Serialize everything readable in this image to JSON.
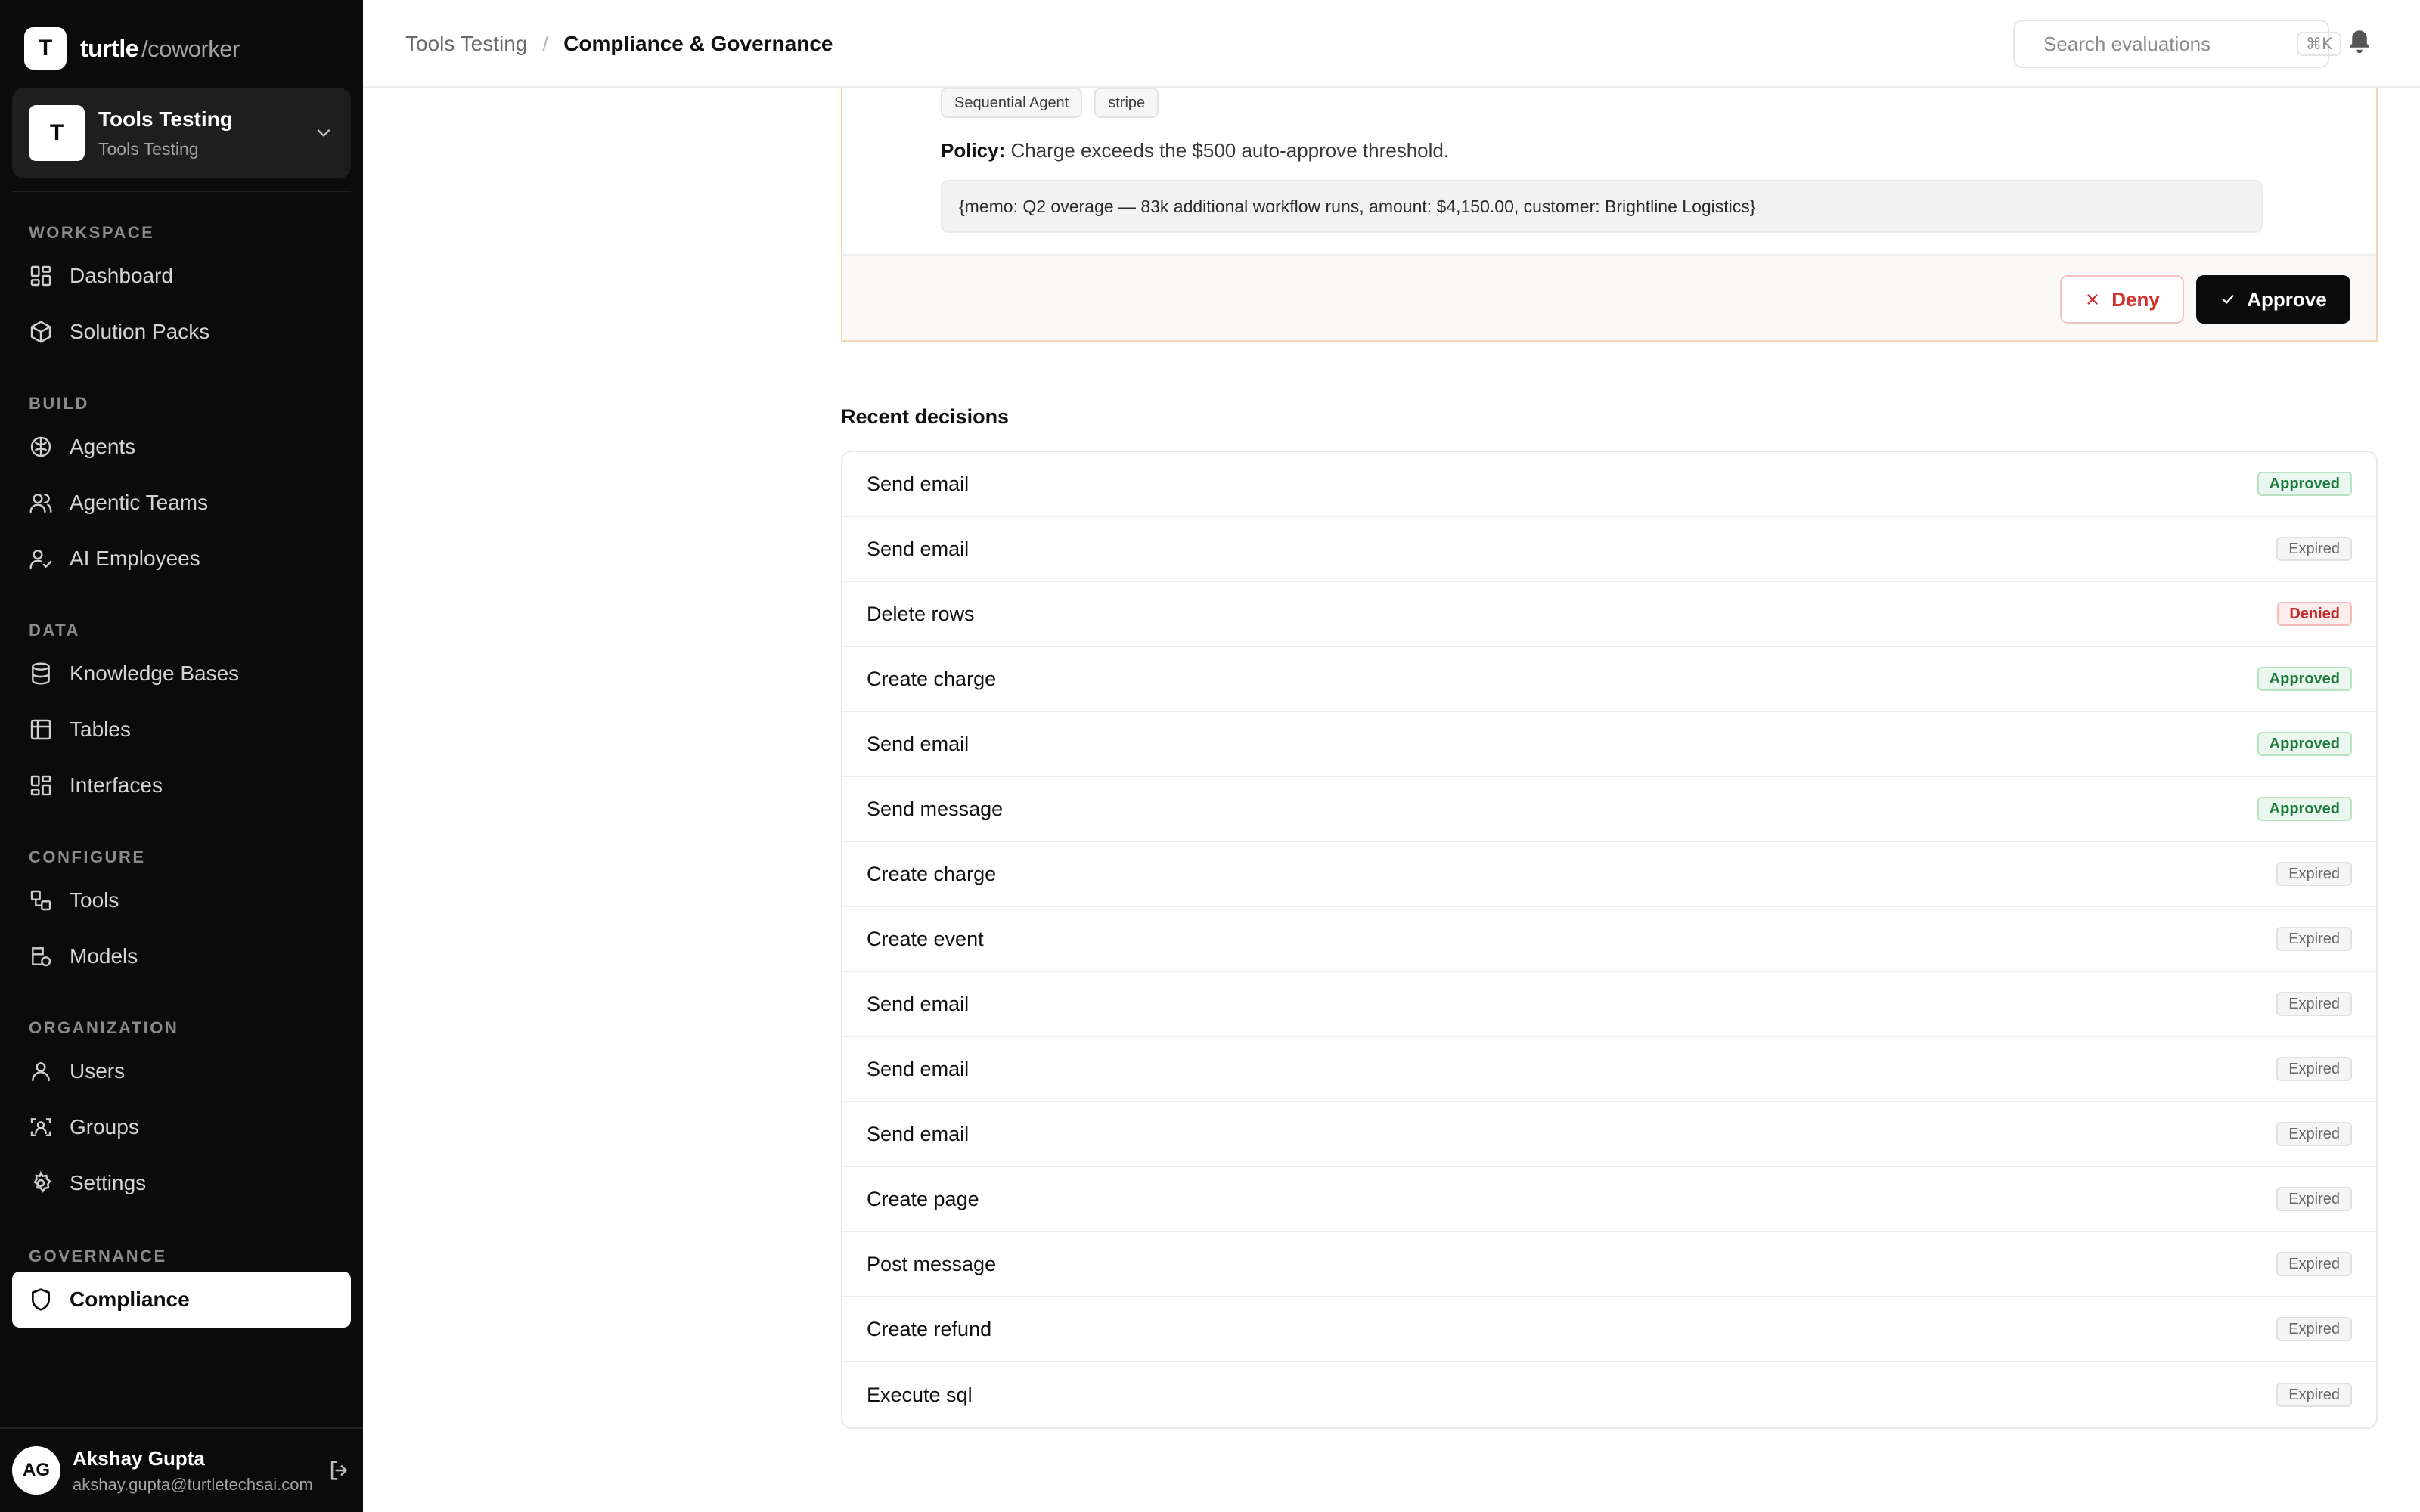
{
  "brand": {
    "logo_letter": "T",
    "name": "turtle",
    "suffix": "/coworker"
  },
  "workspace": {
    "avatar_letter": "T",
    "title": "Tools Testing",
    "subtitle": "Tools Testing"
  },
  "nav": {
    "workspace": {
      "heading": "WORKSPACE",
      "items": [
        "Dashboard",
        "Solution Packs"
      ]
    },
    "build": {
      "heading": "BUILD",
      "items": [
        "Agents",
        "Agentic Teams",
        "AI Employees"
      ]
    },
    "data": {
      "heading": "DATA",
      "items": [
        "Knowledge Bases",
        "Tables",
        "Interfaces"
      ]
    },
    "configure": {
      "heading": "CONFIGURE",
      "items": [
        "Tools",
        "Models"
      ]
    },
    "organization": {
      "heading": "ORGANIZATION",
      "items": [
        "Users",
        "Groups",
        "Settings"
      ]
    },
    "governance": {
      "heading": "GOVERNANCE",
      "items": [
        "Compliance"
      ]
    }
  },
  "user": {
    "initials": "AG",
    "name": "Akshay Gupta",
    "email": "akshay.gupta@turtletechsai.com"
  },
  "header": {
    "breadcrumb_parent": "Tools Testing",
    "breadcrumb_sep": "/",
    "breadcrumb_current": "Compliance & Governance",
    "search_placeholder": "Search evaluations",
    "search_shortcut": "⌘K"
  },
  "pending": {
    "tags": [
      "Sequential Agent",
      "stripe"
    ],
    "policy_label": "Policy:",
    "policy_text": "Charge exceeds the $500 auto-approve threshold.",
    "args": "{memo: Q2 overage — 83k additional workflow runs, amount: $4,150.00, customer: Brightline Logistics}",
    "deny_label": "Deny",
    "approve_label": "Approve"
  },
  "recent": {
    "title": "Recent decisions",
    "rows": [
      {
        "name": "Send email",
        "status": "Approved"
      },
      {
        "name": "Send email",
        "status": "Expired"
      },
      {
        "name": "Delete rows",
        "status": "Denied"
      },
      {
        "name": "Create charge",
        "status": "Approved"
      },
      {
        "name": "Send email",
        "status": "Approved"
      },
      {
        "name": "Send message",
        "status": "Approved"
      },
      {
        "name": "Create charge",
        "status": "Expired"
      },
      {
        "name": "Create event",
        "status": "Expired"
      },
      {
        "name": "Send email",
        "status": "Expired"
      },
      {
        "name": "Send email",
        "status": "Expired"
      },
      {
        "name": "Send email",
        "status": "Expired"
      },
      {
        "name": "Create page",
        "status": "Expired"
      },
      {
        "name": "Post message",
        "status": "Expired"
      },
      {
        "name": "Create refund",
        "status": "Expired"
      },
      {
        "name": "Execute sql",
        "status": "Expired"
      }
    ]
  },
  "colors": {
    "sidebar_bg": "#0b0b0b",
    "approved": "#1f7a3d",
    "denied": "#c62828",
    "expired": "#666666",
    "pending_border": "#f3d7b4"
  }
}
